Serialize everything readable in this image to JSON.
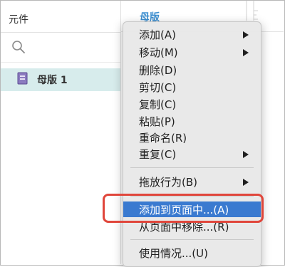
{
  "panel": {
    "title": "元件",
    "master_item": "母版 1"
  },
  "canvas": {
    "tab_label": "母版"
  },
  "menu": {
    "items": [
      {
        "label": "添加(A)",
        "submenu": true
      },
      {
        "label": "移动(M)",
        "submenu": true
      },
      {
        "label": "删除(D)",
        "submenu": false
      },
      {
        "label": "剪切(C)",
        "submenu": false
      },
      {
        "label": "复制(C)",
        "submenu": false
      },
      {
        "label": "粘贴(P)",
        "submenu": false
      },
      {
        "label": "重命名(R)",
        "submenu": false
      },
      {
        "label": "重复(C)",
        "submenu": true
      },
      {
        "label": "拖放行为(B)",
        "submenu": true
      },
      {
        "label": "添加到页面中...(A)",
        "submenu": false,
        "highlighted": true
      },
      {
        "label": "从页面中移除...(R)",
        "submenu": false
      },
      {
        "label": "使用情况...(U)",
        "submenu": false
      }
    ]
  },
  "colors": {
    "highlight": "#3a7ad0",
    "annotation_box": "#e0463b",
    "selected_row": "#d7ecec",
    "accent_text": "#3d8fd0"
  },
  "icons": {
    "search": "search-icon",
    "master": "master-page-icon",
    "submenu": "submenu-arrow-icon"
  }
}
